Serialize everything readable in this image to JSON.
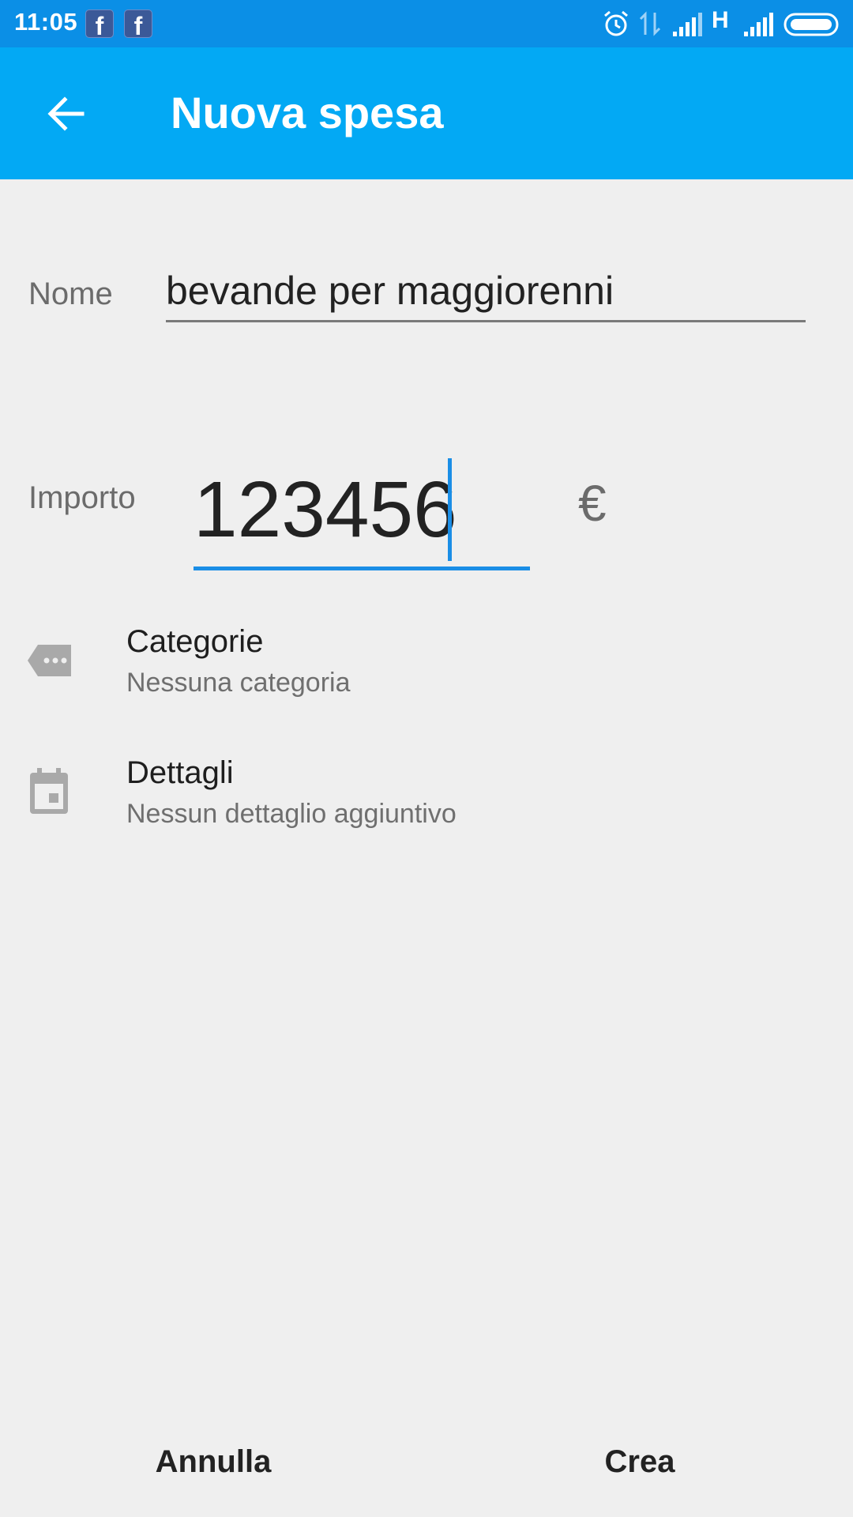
{
  "status_bar": {
    "time": "11:05",
    "network_type": "H",
    "icons": [
      "facebook-icon",
      "facebook-icon",
      "alarm-icon",
      "data-transfer-icon",
      "signal-icon",
      "signal-icon",
      "battery-icon"
    ]
  },
  "app_bar": {
    "title": "Nuova spesa",
    "back_icon": "arrow-back-icon",
    "color": "#03a9f4"
  },
  "form": {
    "name_label": "Nome",
    "name_value": "bevande per maggiorenni",
    "amount_label": "Importo",
    "amount_value": "123456",
    "currency": "€",
    "accent_color": "#1a8ee6"
  },
  "rows": [
    {
      "title": "Categorie",
      "subtitle": "Nessuna categoria",
      "icon": "tag-icon"
    },
    {
      "title": "Dettagli",
      "subtitle": "Nessun dettaglio aggiuntivo",
      "icon": "calendar-icon"
    }
  ],
  "actions": {
    "cancel_label": "Annulla",
    "create_label": "Crea"
  }
}
